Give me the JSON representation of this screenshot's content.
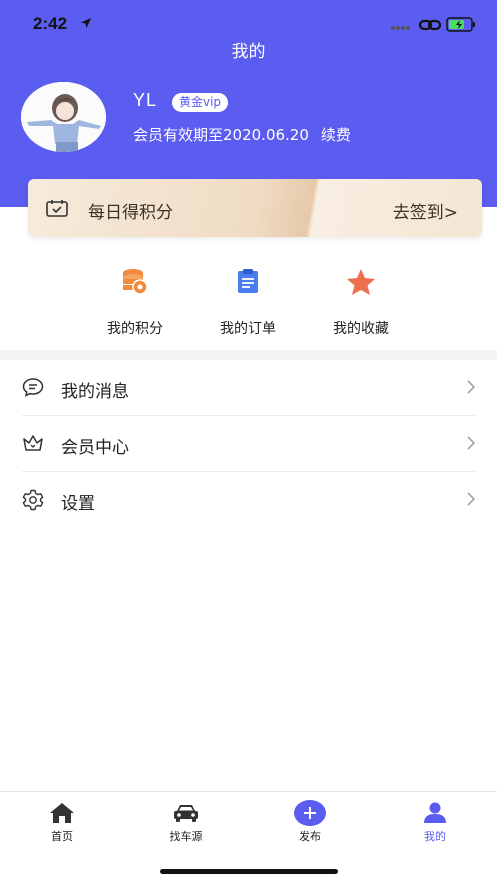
{
  "status_bar": {
    "time": "2:42"
  },
  "header": {
    "title": "我的"
  },
  "profile": {
    "username": "YL",
    "vip_badge": "黄金vip",
    "member_expiry": "会员有效期至2020.06.20",
    "renew_label": "续费"
  },
  "checkin": {
    "title": "每日得积分",
    "action": "去签到>"
  },
  "quick_links": [
    {
      "label": "我的积分",
      "icon": "coins-icon",
      "color": "#f08a3c"
    },
    {
      "label": "我的订单",
      "icon": "clipboard-icon",
      "color": "#4a7cf0"
    },
    {
      "label": "我的收藏",
      "icon": "star-icon",
      "color": "#ee6e50"
    }
  ],
  "menu": [
    {
      "label": "我的消息",
      "icon": "message-icon"
    },
    {
      "label": "会员中心",
      "icon": "crown-icon"
    },
    {
      "label": "设置",
      "icon": "gear-icon"
    }
  ],
  "tabbar": [
    {
      "label": "首页",
      "icon": "home-icon"
    },
    {
      "label": "找车源",
      "icon": "car-icon"
    },
    {
      "label": "发布",
      "icon": "plus-circle-icon"
    },
    {
      "label": "我的",
      "icon": "person-icon",
      "active": true
    }
  ],
  "colors": {
    "accent": "#5b5cf0",
    "battery": "#4cd964"
  }
}
